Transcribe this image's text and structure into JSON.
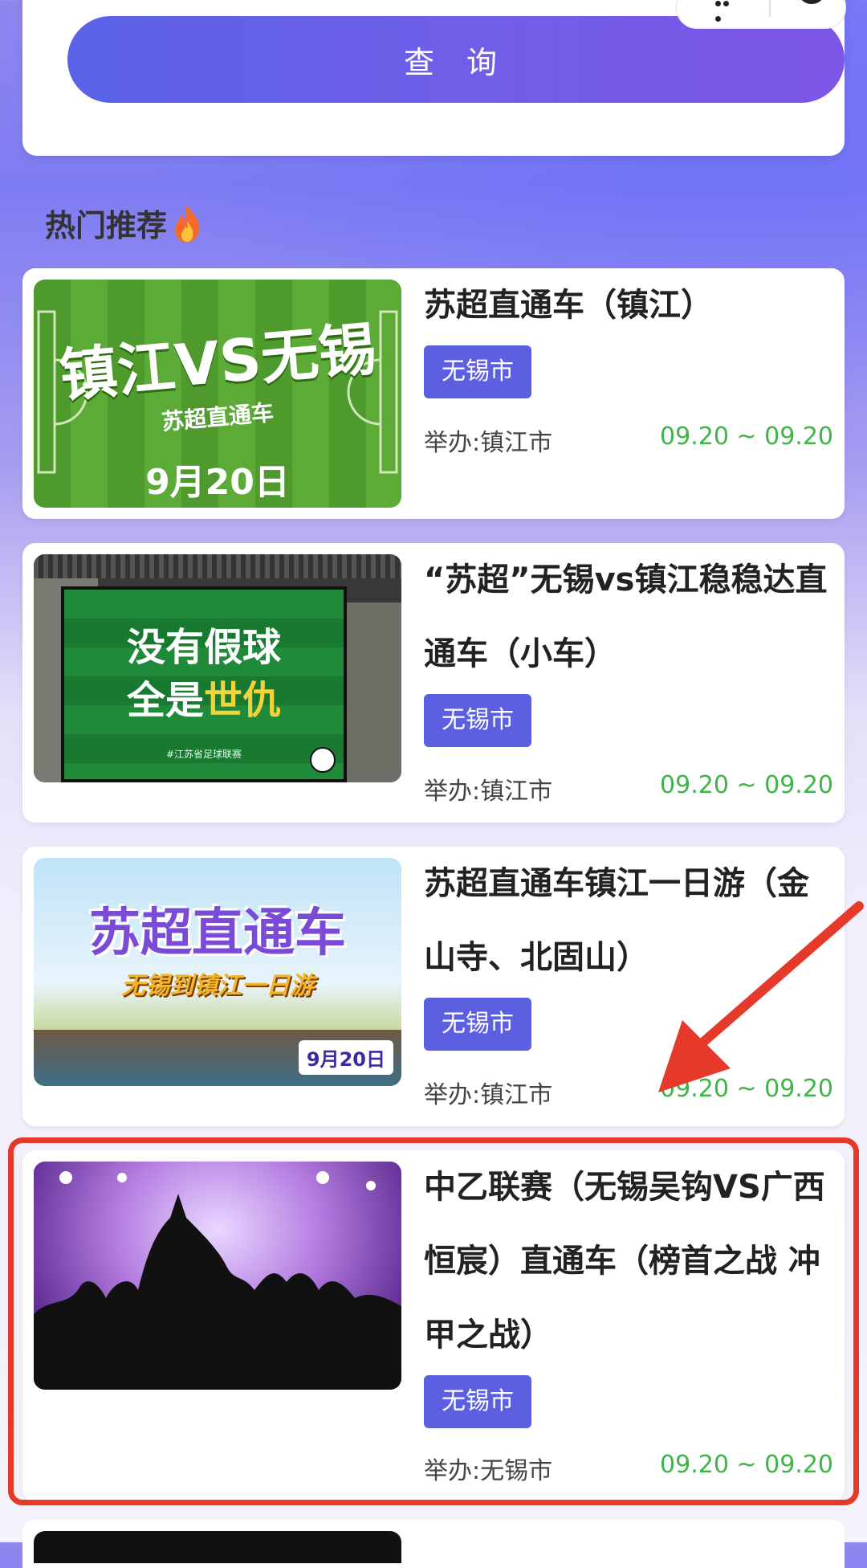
{
  "query_button": "查 询",
  "section_title": "热门推荐",
  "colors": {
    "accent": "#5b5fe0",
    "date_green": "#3fb449",
    "highlight_red": "#e53a2a"
  },
  "cards": [
    {
      "title": "苏超直通车（镇江）",
      "tag": "无锡市",
      "host": "举办:镇江市",
      "date": "09.20 ~ 09.20",
      "thumb": {
        "line1": "镇江VS无锡",
        "line2": "苏超直通车",
        "line3": "9月20日"
      }
    },
    {
      "title": "“苏超”无锡vs镇江稳稳达直通车（小车）",
      "tag": "无锡市",
      "host": "举办:镇江市",
      "date": "09.20 ~ 09.20",
      "thumb": {
        "line1": "没有假球",
        "line2a": "全是",
        "line2b": "世仇",
        "footer": "#江苏省足球联赛"
      }
    },
    {
      "title": "苏超直通车镇江一日游（金山寺、北固山）",
      "tag": "无锡市",
      "host": "举办:镇江市",
      "date": "09.20 ~ 09.20",
      "thumb": {
        "line1": "苏超直通车",
        "line2": "无锡到镇江一日游",
        "badge": "9月20日"
      }
    },
    {
      "title": "中乙联赛（无锡吴钩VS广西恒宸）直通车（榜首之战 冲甲之战）",
      "tag": "无锡市",
      "host": "举办:无锡市",
      "date": "09.20 ~ 09.20"
    }
  ]
}
